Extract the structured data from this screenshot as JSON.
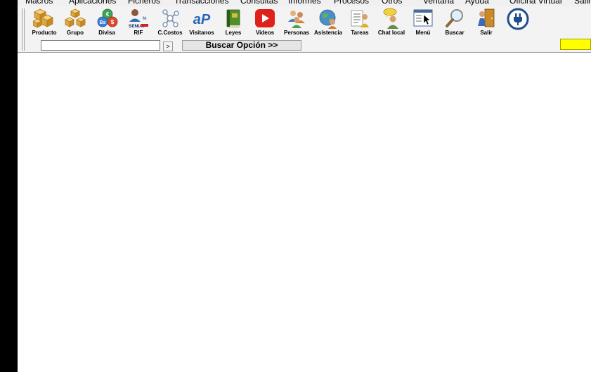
{
  "menu": [
    {
      "label": "Macros"
    },
    {
      "label": "Aplicaciones"
    },
    {
      "label": "Ficheros"
    },
    {
      "label": "Transacciones"
    },
    {
      "label": "Consultas"
    },
    {
      "label": "Informes"
    },
    {
      "label": "Procesos"
    },
    {
      "label": "Otros"
    },
    {
      "label": "Ventana"
    },
    {
      "label": "Ayuda"
    },
    {
      "label": "Oficina Virtual"
    },
    {
      "label": "Salir"
    }
  ],
  "toolbar": {
    "items": [
      {
        "label": "Producto",
        "icon": "boxes-icon"
      },
      {
        "label": "Grupo",
        "icon": "box-group-icon"
      },
      {
        "label": "Divisa",
        "icon": "currency-icon"
      },
      {
        "label": "RIF",
        "icon": "seniat-icon"
      },
      {
        "label": "C.Costos",
        "icon": "cost-center-icon"
      },
      {
        "label": "Visitanos",
        "icon": "ap-logo-icon"
      },
      {
        "label": "Leyes",
        "icon": "law-book-icon"
      },
      {
        "label": "Videos",
        "icon": "video-play-icon"
      },
      {
        "label": "Personas",
        "icon": "people-icon"
      },
      {
        "label": "Asistencia",
        "icon": "globe-person-icon"
      },
      {
        "label": "Tareas",
        "icon": "tasks-icon"
      },
      {
        "label": "Chat local",
        "icon": "chat-icon"
      },
      {
        "label": "Menú",
        "icon": "menu-window-icon"
      },
      {
        "label": "Buscar",
        "icon": "magnifier-icon"
      },
      {
        "label": "Salir",
        "icon": "exit-door-icon"
      }
    ],
    "power_icon": "power-plug-icon"
  },
  "search": {
    "value": "",
    "go_label": ">",
    "option_label": "Buscar Opción >>"
  },
  "colors": {
    "indicator": "#ffff00",
    "power_icon": "#1f4e8c",
    "video_red": "#e0201a"
  }
}
